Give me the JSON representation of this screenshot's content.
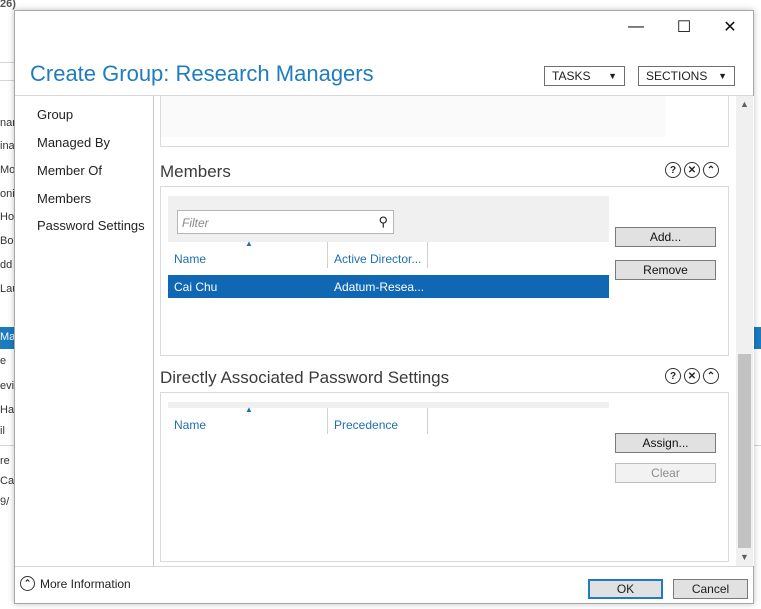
{
  "background": {
    "title_fragment": "26)",
    "cut_labels": [
      "nar",
      "ina",
      "Mo",
      "oni",
      "Hol",
      "Bo",
      "dd",
      "Lau",
      "Ma",
      "e",
      "evid",
      "Ha",
      "il",
      "re",
      "Ca",
      "9/"
    ]
  },
  "window": {
    "title": "Create Group: Research Managers",
    "caption": {
      "minimize": "—",
      "maximize": "☐",
      "close": "✕"
    },
    "tasks_label": "TASKS",
    "sections_label": "SECTIONS"
  },
  "nav": {
    "items": [
      {
        "label": "Group"
      },
      {
        "label": "Managed By"
      },
      {
        "label": "Member Of"
      },
      {
        "label": "Members"
      },
      {
        "label": "Password Settings"
      }
    ]
  },
  "members_section": {
    "title": "Members",
    "filter_placeholder": "Filter",
    "columns": [
      "Name",
      "Active Director..."
    ],
    "rows": [
      {
        "name": "Cai Chu",
        "ad": "Adatum-Resea..."
      }
    ],
    "add_label": "Add...",
    "remove_label": "Remove"
  },
  "password_section": {
    "title": "Directly Associated Password Settings",
    "columns": [
      "Name",
      "Precedence"
    ],
    "assign_label": "Assign...",
    "clear_label": "Clear"
  },
  "footer": {
    "more_info": "More Information",
    "ok_label": "OK",
    "cancel_label": "Cancel"
  }
}
